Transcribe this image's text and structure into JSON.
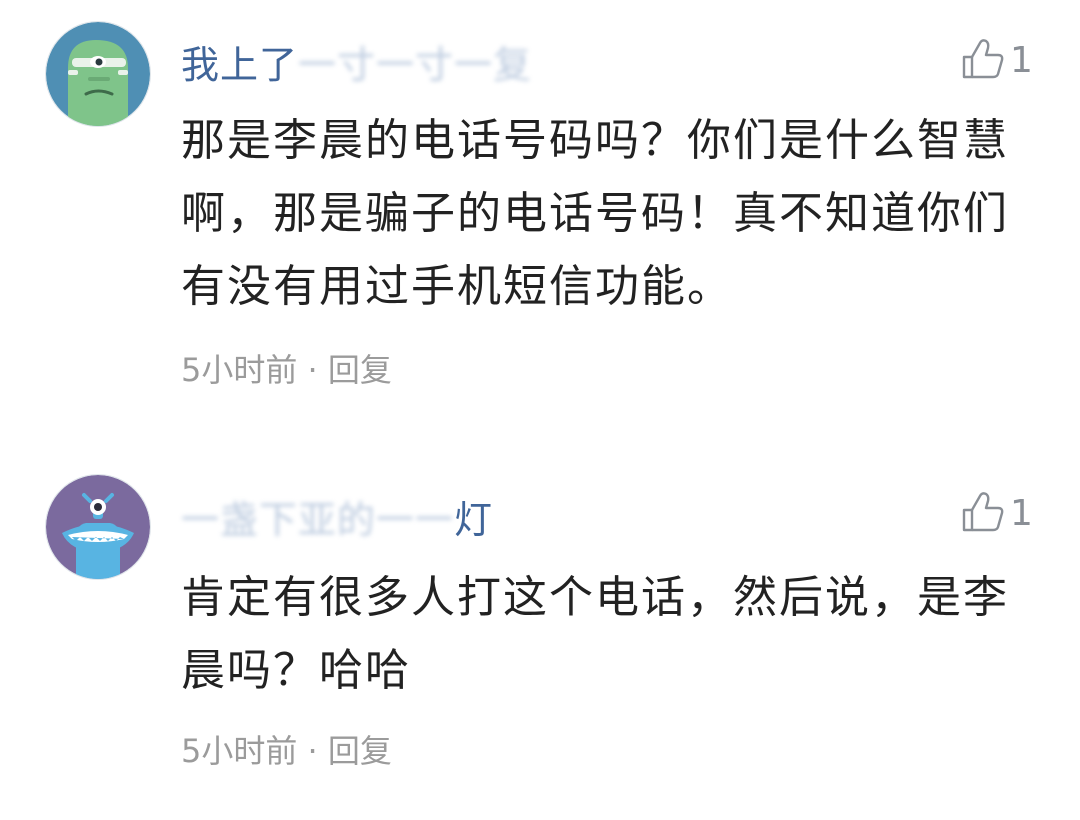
{
  "comments": [
    {
      "username_visible": "我上了",
      "username_obscured": "一寸一寸一复",
      "body": "那是李晨的电话号码吗？你们是什么智慧啊，那是骗子的电话号码！真不知道你们有没有用过手机短信功能。",
      "like_count": "1",
      "like_icon": "thumb-up-outline-icon",
      "time": "5小时前",
      "separator": "·",
      "reply_label": "回复",
      "avatar": {
        "kind": "green-monster-avatar",
        "bg": "#4f8fb4",
        "color": "#7fc48a"
      }
    },
    {
      "username_obscured": "一盏下亚的一一",
      "username_visible": "灯",
      "body": "肯定有很多人打这个电话，然后说，是李晨吗？哈哈",
      "like_count": "1",
      "like_icon": "thumb-up-outline-icon",
      "time": "5小时前",
      "separator": "·",
      "reply_label": "回复",
      "avatar": {
        "kind": "blue-monster-avatar",
        "bg": "#7b6a9e",
        "color": "#58b4e2"
      }
    }
  ],
  "colors": {
    "username": "#406599",
    "body_text": "#222222",
    "meta_text": "#9b9b9b",
    "icon": "#8a8f96"
  }
}
